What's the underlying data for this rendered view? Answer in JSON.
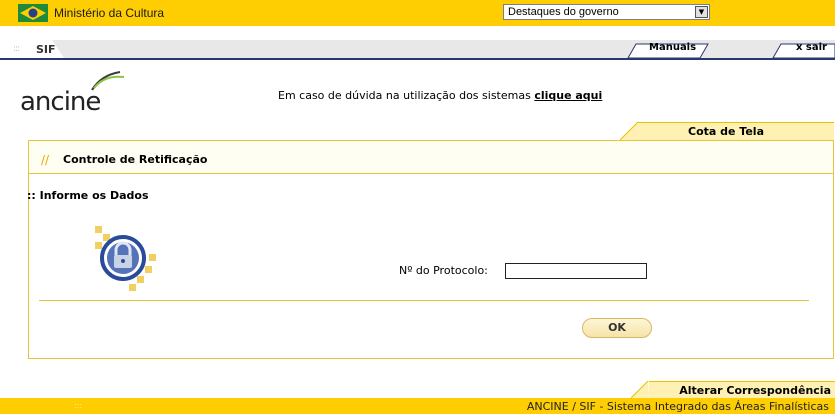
{
  "gov_bar": {
    "title": "Ministério da Cultura",
    "select_value": "Destaques do governo",
    "colors": {
      "background": "#fece02"
    }
  },
  "menu": {
    "home_label": "SIF",
    "manuals_label": "Manuais",
    "exit_label": "x sair"
  },
  "header": {
    "logo_text": "ancine",
    "help_text": "Em caso de dúvida na utilização dos sistemas",
    "help_link": "clique aqui"
  },
  "tabs": {
    "active": "Cota de Tela"
  },
  "section": {
    "slashes": "//",
    "title": "Controle de Retificação"
  },
  "form": {
    "heading": ":: Informe os Dados",
    "protocol_label": "Nº do Protocolo:",
    "protocol_value": "",
    "ok_label": "OK"
  },
  "footer": {
    "tab_label": "Alterar Correspondência",
    "bar_text": "ANCINE / SIF - Sistema Integrado das Áreas Finalísticas",
    "dots": ":::"
  }
}
